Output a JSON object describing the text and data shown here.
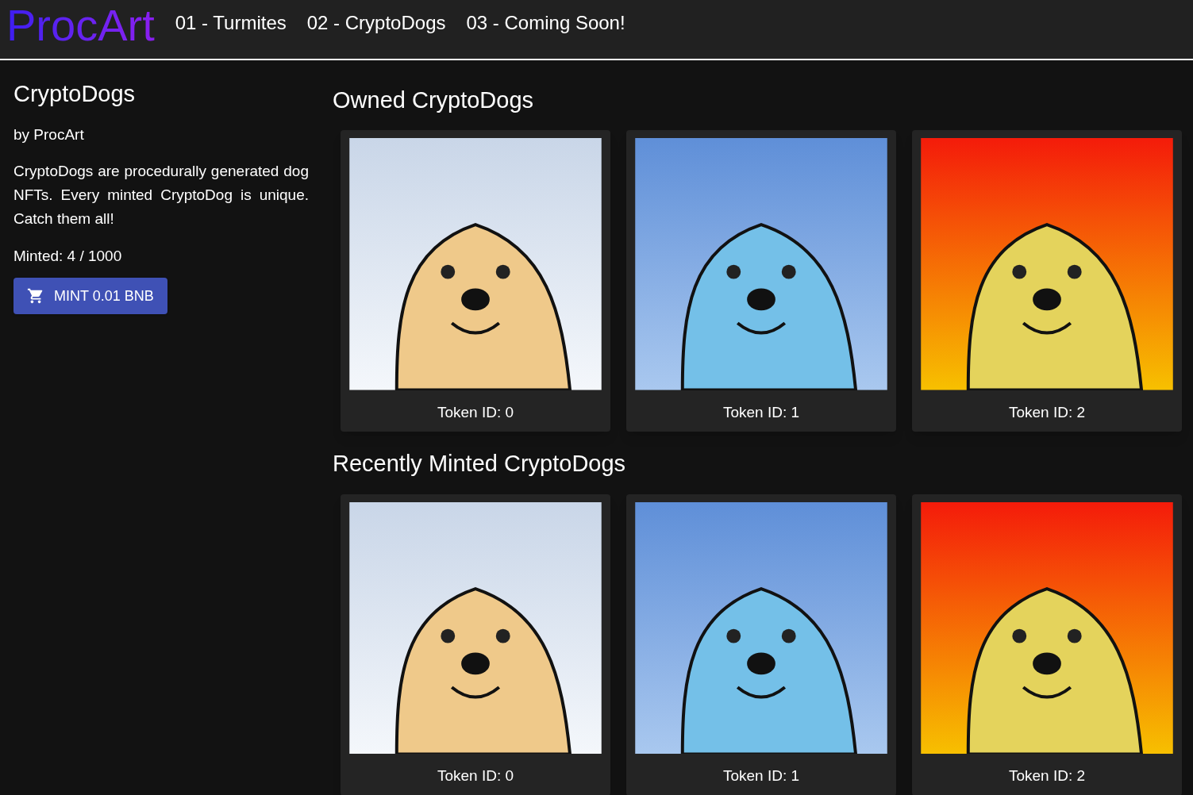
{
  "header": {
    "logo": "ProcArt",
    "nav": [
      {
        "label": "01 - Turmites"
      },
      {
        "label": "02 - CryptoDogs"
      },
      {
        "label": "03 - Coming Soon!"
      }
    ]
  },
  "sidebar": {
    "title": "CryptoDogs",
    "byline": "by ProcArt",
    "description": "CryptoDogs are procedurally generated dog NFTs. Every minted CryptoDog is unique. Catch them all!",
    "minted": "Minted: 4 / 1000",
    "mint_button": "MINT 0.01 BNB"
  },
  "sections": [
    {
      "title": "Owned CryptoDogs",
      "cards": [
        {
          "kind": "snow",
          "label": "Token ID: 0"
        },
        {
          "kind": "sky",
          "label": "Token ID: 1"
        },
        {
          "kind": "sunset",
          "label": "Token ID: 2"
        }
      ]
    },
    {
      "title": "Recently Minted CryptoDogs",
      "cards": [
        {
          "kind": "snow",
          "label": "Token ID: 0"
        },
        {
          "kind": "sky",
          "label": "Token ID: 1"
        },
        {
          "kind": "sunset",
          "label": "Token ID: 2"
        }
      ]
    }
  ]
}
